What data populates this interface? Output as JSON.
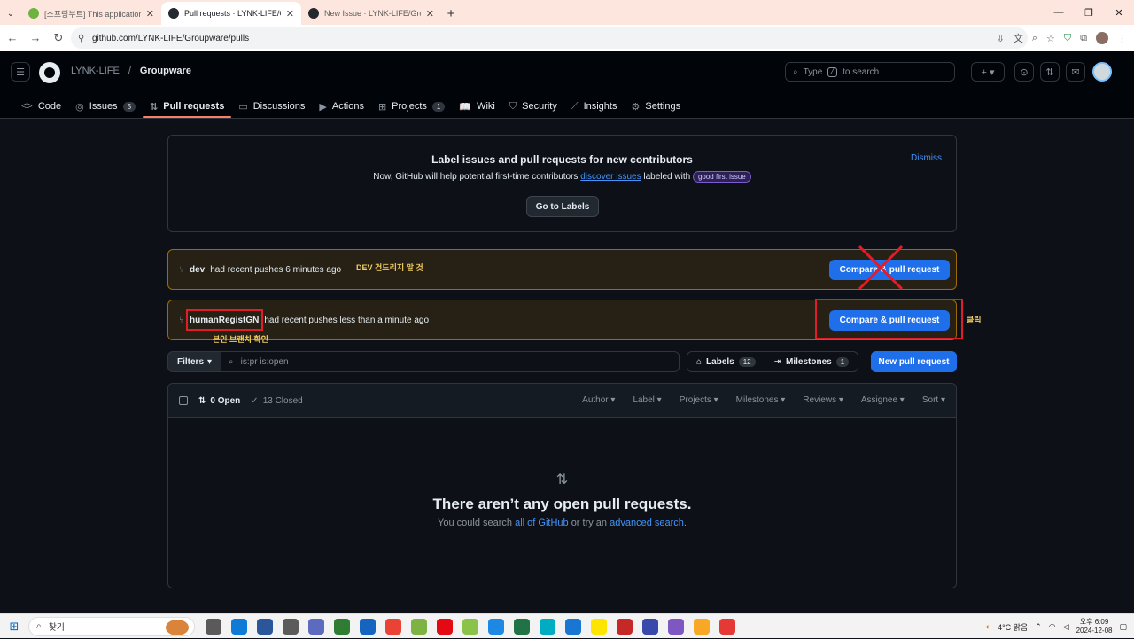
{
  "browser": {
    "tabs": [
      {
        "title": "[스프링부트] This application h",
        "fav": "#6db33f",
        "active": false
      },
      {
        "title": "Pull requests · LYNK-LIFE/Grou",
        "fav": "#24292f",
        "active": true
      },
      {
        "title": "New Issue · LYNK-LIFE/Groupw",
        "fav": "#24292f",
        "active": false
      }
    ],
    "url": "github.com/LYNK-LIFE/Groupware/pulls"
  },
  "header": {
    "owner": "LYNK-LIFE",
    "separator": "/",
    "repo": "Groupware",
    "search_placeholder_pre": "Type",
    "search_key": "/",
    "search_placeholder_post": "to search"
  },
  "repo_nav": [
    {
      "icon": "code-icon",
      "glyph": "<>",
      "label": "Code",
      "count": ""
    },
    {
      "icon": "issues-icon",
      "glyph": "◎",
      "label": "Issues",
      "count": "5"
    },
    {
      "icon": "pull-request-icon",
      "glyph": "⇅",
      "label": "Pull requests",
      "count": "",
      "selected": true
    },
    {
      "icon": "discussions-icon",
      "glyph": "▭",
      "label": "Discussions",
      "count": ""
    },
    {
      "icon": "actions-icon",
      "glyph": "▶",
      "label": "Actions",
      "count": ""
    },
    {
      "icon": "projects-icon",
      "glyph": "⊞",
      "label": "Projects",
      "count": "1"
    },
    {
      "icon": "wiki-icon",
      "glyph": "📖",
      "label": "Wiki",
      "count": ""
    },
    {
      "icon": "security-icon",
      "glyph": "⛉",
      "label": "Security",
      "count": ""
    },
    {
      "icon": "insights-icon",
      "glyph": "⟋",
      "label": "Insights",
      "count": ""
    },
    {
      "icon": "settings-icon",
      "glyph": "⚙",
      "label": "Settings",
      "count": ""
    }
  ],
  "banner": {
    "title": "Label issues and pull requests for new contributors",
    "text_pre": "Now, GitHub will help potential first-time contributors",
    "link": "discover issues",
    "text_post": "labeled with",
    "badge": "good first issue",
    "dismiss": "Dismiss",
    "button": "Go to Labels"
  },
  "pushes": [
    {
      "branch": "dev",
      "text": "had recent pushes 6 minutes ago",
      "button": "Compare & pull request"
    },
    {
      "branch": "humanRegistGN",
      "text": "had recent pushes less than a minute ago",
      "button": "Compare & pull request"
    }
  ],
  "annotations": {
    "dev_note": "DEV 건드리지 말 것",
    "branch_note": "본인 브랜치 확인",
    "click_note": "클릭"
  },
  "filters": {
    "button": "Filters",
    "query": "is:pr is:open",
    "labels": "Labels",
    "labels_count": "12",
    "milestones": "Milestones",
    "milestones_count": "1",
    "new_pr": "New pull request"
  },
  "list": {
    "open": "0 Open",
    "closed": "13 Closed",
    "sorts": [
      "Author",
      "Label",
      "Projects",
      "Milestones",
      "Reviews",
      "Assignee",
      "Sort"
    ],
    "empty_title": "There aren’t any open pull requests.",
    "empty_pre": "You could search",
    "empty_link1": "all of GitHub",
    "empty_mid": "or try an",
    "empty_link2": "advanced search",
    "empty_post": "."
  },
  "taskbar": {
    "search": "찾기",
    "weather": "4°C  맑음",
    "time": "오후 6:09",
    "date": "2024-12-08",
    "apps": [
      "#5a5a5a",
      "#0f7bd6",
      "#2b579a",
      "#5b5b5b",
      "#5c6bc0",
      "#2e7d32",
      "#1565c0",
      "#ea4335",
      "#7cb342",
      "#e50914",
      "#8bc34a",
      "#1e88e5",
      "#217346",
      "#00acc1",
      "#1976d2",
      "#fee500",
      "#c62828",
      "#3949ab",
      "#7e57c2",
      "#f9a825",
      "#e53935"
    ]
  }
}
